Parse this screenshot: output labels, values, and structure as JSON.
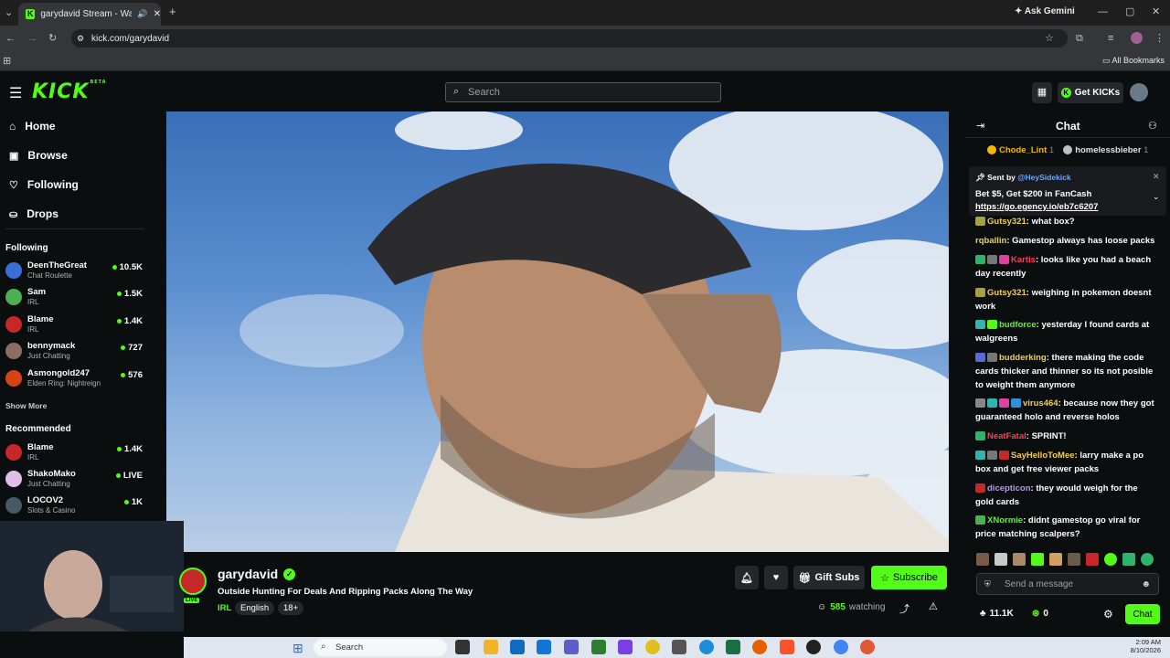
{
  "browser": {
    "tab_title": "garydavid Stream - Watch l",
    "url": "kick.com/garydavid",
    "ask_gemini": "Ask Gemini",
    "all_bookmarks": "All Bookmarks"
  },
  "header": {
    "logo": "KICK",
    "logo_badge": "BETA",
    "search_placeholder": "Search",
    "get_kicks": "Get KICKs"
  },
  "sidebar": {
    "nav": [
      {
        "label": "Home",
        "icon": "home-icon"
      },
      {
        "label": "Browse",
        "icon": "browse-icon"
      },
      {
        "label": "Following",
        "icon": "heart-icon"
      },
      {
        "label": "Drops",
        "icon": "drops-icon"
      }
    ],
    "following_heading": "Following",
    "following": [
      {
        "name": "DeenTheGreat",
        "category": "Chat Roulette",
        "viewers": "10.5K",
        "color": "#3b6fd8"
      },
      {
        "name": "Sam",
        "category": "IRL",
        "viewers": "1.5K",
        "color": "#4caf50"
      },
      {
        "name": "Blame",
        "category": "IRL",
        "viewers": "1.4K",
        "color": "#c62828"
      },
      {
        "name": "bennymack",
        "category": "Just Chatting",
        "viewers": "727",
        "color": "#8d6e63"
      },
      {
        "name": "Asmongold247",
        "category": "Elden Ring: Nightreign",
        "viewers": "576",
        "color": "#d84315"
      }
    ],
    "show_more": "Show More",
    "recommended_heading": "Recommended",
    "recommended": [
      {
        "name": "Blame",
        "category": "IRL",
        "viewers": "1.4K",
        "color": "#c62828"
      },
      {
        "name": "ShakoMako",
        "category": "Just Chatting",
        "viewers": "LIVE",
        "color": "#e1bee7"
      },
      {
        "name": "LOCOV2",
        "category": "Slots & Casino",
        "viewers": "1K",
        "color": "#455a64"
      }
    ]
  },
  "stream": {
    "channel": "garydavid",
    "title": "Outside Hunting For Deals And Ripping Packs Along The Way",
    "category": "IRL",
    "tags": [
      "English",
      "18+"
    ],
    "avatar_live": "LIVE",
    "viewers": "585",
    "watching_label": "watching",
    "gift_subs": "Gift Subs",
    "subscribe": "Subscribe"
  },
  "chat": {
    "title": "Chat",
    "top_gifters": [
      {
        "name": "Chode_Lint",
        "rank": "1",
        "color": "#f5b800"
      },
      {
        "name": "homelessbieber",
        "rank": "1",
        "color": "#c0c0c0"
      }
    ],
    "pinned": {
      "sent_by_label": "Sent by",
      "sent_by": "@HeySidekick",
      "text": "Bet $5, Get $200 in FanCash",
      "link": "https://go.egency.io/eb7c6207"
    },
    "messages": [
      {
        "user": "Gutsy321",
        "color": "#f2d04d",
        "text": "what box?"
      },
      {
        "user": "rqballin",
        "color": "#f2d04d",
        "text": "Gamestop always has loose packs"
      },
      {
        "user": "Kartis",
        "color": "#ff3b5b",
        "text": "looks like you had a beach day recently"
      },
      {
        "user": "Gutsy321",
        "color": "#f2d04d",
        "text": "weighing in pokemon doesnt work"
      },
      {
        "user": "budforce",
        "color": "#53fc18",
        "text": "yesterday I found cards at walgreens"
      },
      {
        "user": "budderking",
        "color": "#f2d04d",
        "text": "there making the code cards thicker and thinner so its not posible to weight them anymore"
      },
      {
        "user": "virus464",
        "color": "#f2d04d",
        "text": "because now they got guaranteed holo and reverse holos"
      },
      {
        "user": "NeatFatal",
        "color": "#ff3b5b",
        "text": "SPRINT!"
      },
      {
        "user": "SayHelloToMee",
        "color": "#f2d04d",
        "text": "larry make a po box and get free viewer packs"
      },
      {
        "user": "dicepticon",
        "color": "#b39ddb",
        "text": "they would weigh for the gold cards"
      },
      {
        "user": "XNormie",
        "color": "#53fc18",
        "text": "didnt gamestop go viral for price matching scalpers?"
      }
    ],
    "input_placeholder": "Send a message",
    "kicks_count": "11.1K",
    "points": "0",
    "chat_button": "Chat"
  },
  "taskbar": {
    "search": "Search",
    "time": "2:09 AM",
    "date": "8/10/2026"
  }
}
